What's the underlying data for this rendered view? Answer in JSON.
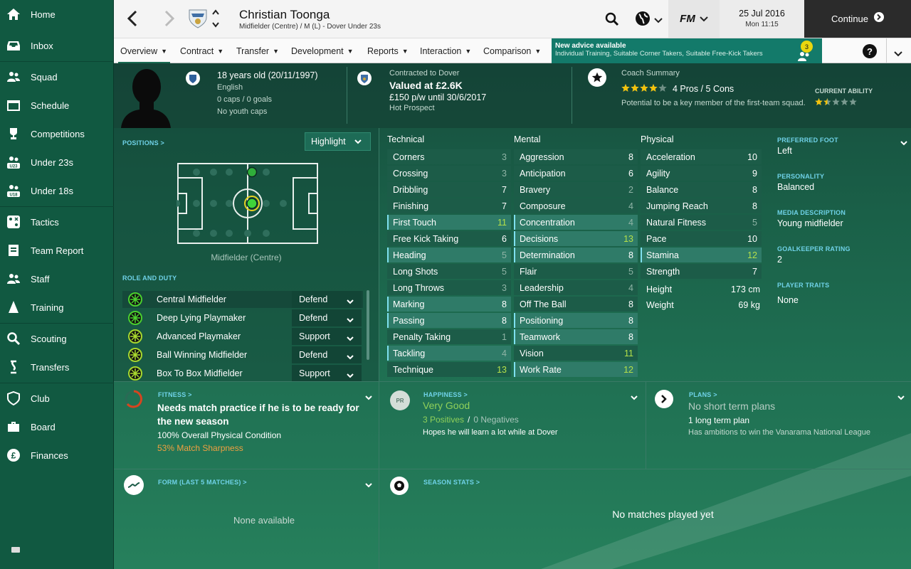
{
  "sidebar": {
    "items": [
      {
        "label": "Home",
        "icon": "home-icon"
      },
      {
        "label": "Inbox",
        "icon": "inbox-icon"
      },
      {
        "label": "Squad",
        "icon": "squad-icon"
      },
      {
        "label": "Schedule",
        "icon": "calendar-icon"
      },
      {
        "label": "Competitions",
        "icon": "trophy-icon"
      },
      {
        "label": "Under 23s",
        "icon": "under23-icon"
      },
      {
        "label": "Under 18s",
        "icon": "under18-icon"
      },
      {
        "label": "Tactics",
        "icon": "tactics-icon"
      },
      {
        "label": "Team Report",
        "icon": "report-icon"
      },
      {
        "label": "Staff",
        "icon": "staff-icon"
      },
      {
        "label": "Training",
        "icon": "training-icon"
      },
      {
        "label": "Scouting",
        "icon": "scouting-icon"
      },
      {
        "label": "Transfers",
        "icon": "transfers-icon"
      },
      {
        "label": "Club",
        "icon": "club-icon"
      },
      {
        "label": "Board",
        "icon": "board-icon"
      },
      {
        "label": "Finances",
        "icon": "finances-icon"
      }
    ]
  },
  "header": {
    "player_name": "Christian Toonga",
    "player_subtitle": "Midfielder (Centre) / M (L) - Dover Under 23s",
    "fm_label": "FM",
    "date": "25 Jul 2016",
    "time": "Mon 11:15",
    "continue_label": "Continue"
  },
  "nav": {
    "tabs": [
      "Overview",
      "Contract",
      "Transfer",
      "Development",
      "Reports",
      "Interaction",
      "Comparison"
    ],
    "advice_title": "New advice available",
    "advice_text": "Individual Training, Suitable Corner Takers, Suitable Free-Kick Takers",
    "advice_count": "3",
    "help_label": "?"
  },
  "info": {
    "age": "18 years old (20/11/1997)",
    "nationality": "English",
    "caps": "0 caps / 0 goals",
    "youth_caps": "No youth caps",
    "contracted": "Contracted to Dover",
    "valued": "Valued at £2.6K",
    "wage": "£150 p/w until 30/6/2017",
    "status": "Hot Prospect",
    "coach_title": "Coach Summary",
    "pros_cons": "4 Pros / 5 Cons",
    "coach_text": "Potential to be a key member of the first-team squad.",
    "coach_stars": 4,
    "current_ability_label": "CURRENT ABILITY",
    "current_ability_stars": 1.5
  },
  "positions": {
    "title": "POSITIONS >",
    "highlight_label": "Highlight",
    "position_name": "Midfielder (Centre)",
    "role_title": "ROLE AND DUTY",
    "roles": [
      {
        "name": "Central Midfielder",
        "duty": "Defend"
      },
      {
        "name": "Deep Lying Playmaker",
        "duty": "Defend"
      },
      {
        "name": "Advanced Playmaker",
        "duty": "Support"
      },
      {
        "name": "Ball Winning Midfielder",
        "duty": "Defend"
      },
      {
        "name": "Box To Box Midfielder",
        "duty": "Support"
      }
    ]
  },
  "attributes": {
    "technical_title": "Technical",
    "mental_title": "Mental",
    "physical_title": "Physical",
    "technical": [
      {
        "name": "Corners",
        "value": "3",
        "hl": false
      },
      {
        "name": "Crossing",
        "value": "3",
        "hl": false
      },
      {
        "name": "Dribbling",
        "value": "7",
        "hl": false
      },
      {
        "name": "Finishing",
        "value": "7",
        "hl": false
      },
      {
        "name": "First Touch",
        "value": "11",
        "hl": true
      },
      {
        "name": "Free Kick Taking",
        "value": "6",
        "hl": false
      },
      {
        "name": "Heading",
        "value": "5",
        "hl": true
      },
      {
        "name": "Long Shots",
        "value": "5",
        "hl": false
      },
      {
        "name": "Long Throws",
        "value": "3",
        "hl": false
      },
      {
        "name": "Marking",
        "value": "8",
        "hl": true
      },
      {
        "name": "Passing",
        "value": "8",
        "hl": true
      },
      {
        "name": "Penalty Taking",
        "value": "1",
        "hl": false
      },
      {
        "name": "Tackling",
        "value": "4",
        "hl": true
      },
      {
        "name": "Technique",
        "value": "13",
        "hl": false
      }
    ],
    "mental": [
      {
        "name": "Aggression",
        "value": "8",
        "hl": false
      },
      {
        "name": "Anticipation",
        "value": "6",
        "hl": false
      },
      {
        "name": "Bravery",
        "value": "2",
        "hl": false
      },
      {
        "name": "Composure",
        "value": "4",
        "hl": false
      },
      {
        "name": "Concentration",
        "value": "4",
        "hl": true
      },
      {
        "name": "Decisions",
        "value": "13",
        "hl": true
      },
      {
        "name": "Determination",
        "value": "8",
        "hl": true
      },
      {
        "name": "Flair",
        "value": "5",
        "hl": false
      },
      {
        "name": "Leadership",
        "value": "4",
        "hl": false
      },
      {
        "name": "Off The Ball",
        "value": "8",
        "hl": false
      },
      {
        "name": "Positioning",
        "value": "8",
        "hl": true
      },
      {
        "name": "Teamwork",
        "value": "8",
        "hl": true
      },
      {
        "name": "Vision",
        "value": "11",
        "hl": false
      },
      {
        "name": "Work Rate",
        "value": "12",
        "hl": true
      }
    ],
    "physical": [
      {
        "name": "Acceleration",
        "value": "10",
        "hl": false
      },
      {
        "name": "Agility",
        "value": "9",
        "hl": false
      },
      {
        "name": "Balance",
        "value": "8",
        "hl": false
      },
      {
        "name": "Jumping Reach",
        "value": "8",
        "hl": false
      },
      {
        "name": "Natural Fitness",
        "value": "5",
        "hl": false
      },
      {
        "name": "Pace",
        "value": "10",
        "hl": false
      },
      {
        "name": "Stamina",
        "value": "12",
        "hl": true
      },
      {
        "name": "Strength",
        "value": "7",
        "hl": false
      }
    ],
    "height_label": "Height",
    "height": "173 cm",
    "weight_label": "Weight",
    "weight": "69 kg"
  },
  "profile": {
    "pref_foot_label": "PREFERRED FOOT",
    "pref_foot": "Left",
    "personality_label": "PERSONALITY",
    "personality": "Balanced",
    "media_label": "MEDIA DESCRIPTION",
    "media": "Young midfielder",
    "gk_label": "GOALKEEPER RATING",
    "gk": "2",
    "traits_label": "PLAYER TRAITS",
    "traits": "None"
  },
  "fitness": {
    "title": "FITNESS >",
    "headline": "Needs match practice if he is to be ready for the new season",
    "condition": "100% Overall Physical Condition",
    "sharpness": "53% Match Sharpness"
  },
  "happiness": {
    "title": "HAPPINESS >",
    "badge": "PR",
    "status": "Very Good",
    "positives": "3 Positives",
    "sep": "/",
    "negatives": "0 Negatives",
    "note": "Hopes he will learn a lot while at Dover"
  },
  "plans": {
    "title": "PLANS >",
    "short": "No short term plans",
    "long": "1 long term plan",
    "note": "Has ambitions to win the Vanarama National League"
  },
  "form": {
    "title": "FORM (LAST 5 MATCHES) >",
    "empty": "None available"
  },
  "season": {
    "title": "SEASON STATS >",
    "empty": "No matches played yet"
  },
  "colors": {
    "accent": "#6fd2e8",
    "high": "#b5e04a",
    "low": "#8fb4a6",
    "sharpness": "#f0a040",
    "happiness": "#8fd05a"
  }
}
